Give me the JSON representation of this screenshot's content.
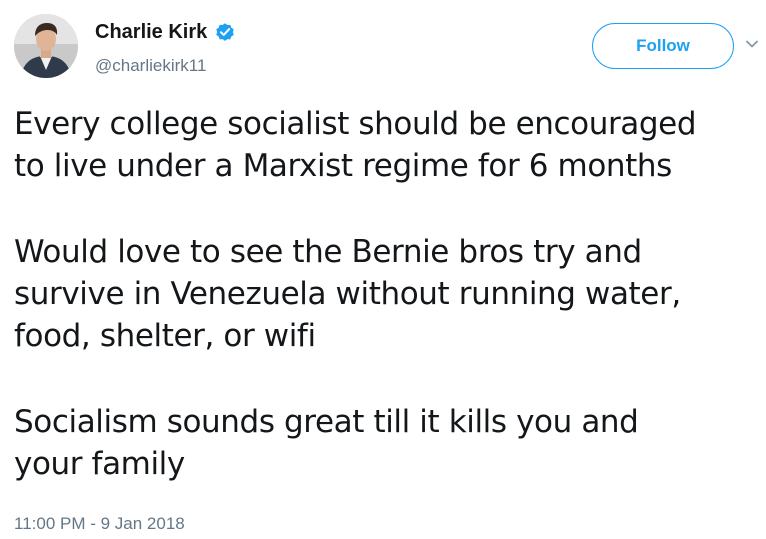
{
  "author": {
    "display_name": "Charlie Kirk",
    "handle": "@charliekirk11",
    "verified": true,
    "avatar_icon": "profile-photo"
  },
  "actions": {
    "follow_label": "Follow",
    "menu_icon": "chevron-down-icon"
  },
  "tweet": {
    "paragraphs": [
      {
        "lines": [
          "Every college socialist should be encouraged",
          "to live under a Marxist regime for 6 months"
        ]
      },
      {
        "lines": [
          "Would love to see the Bernie bros try and",
          "survive in Venezuela without running water,",
          "food, shelter, or wifi"
        ]
      },
      {
        "lines": [
          "Socialism sounds great till it kills you and",
          "your family"
        ]
      }
    ],
    "timestamp": "11:00 PM - 9 Jan 2018"
  },
  "colors": {
    "brand_blue": "#1da1f2",
    "text_primary": "#14171a",
    "text_secondary": "#657786"
  }
}
